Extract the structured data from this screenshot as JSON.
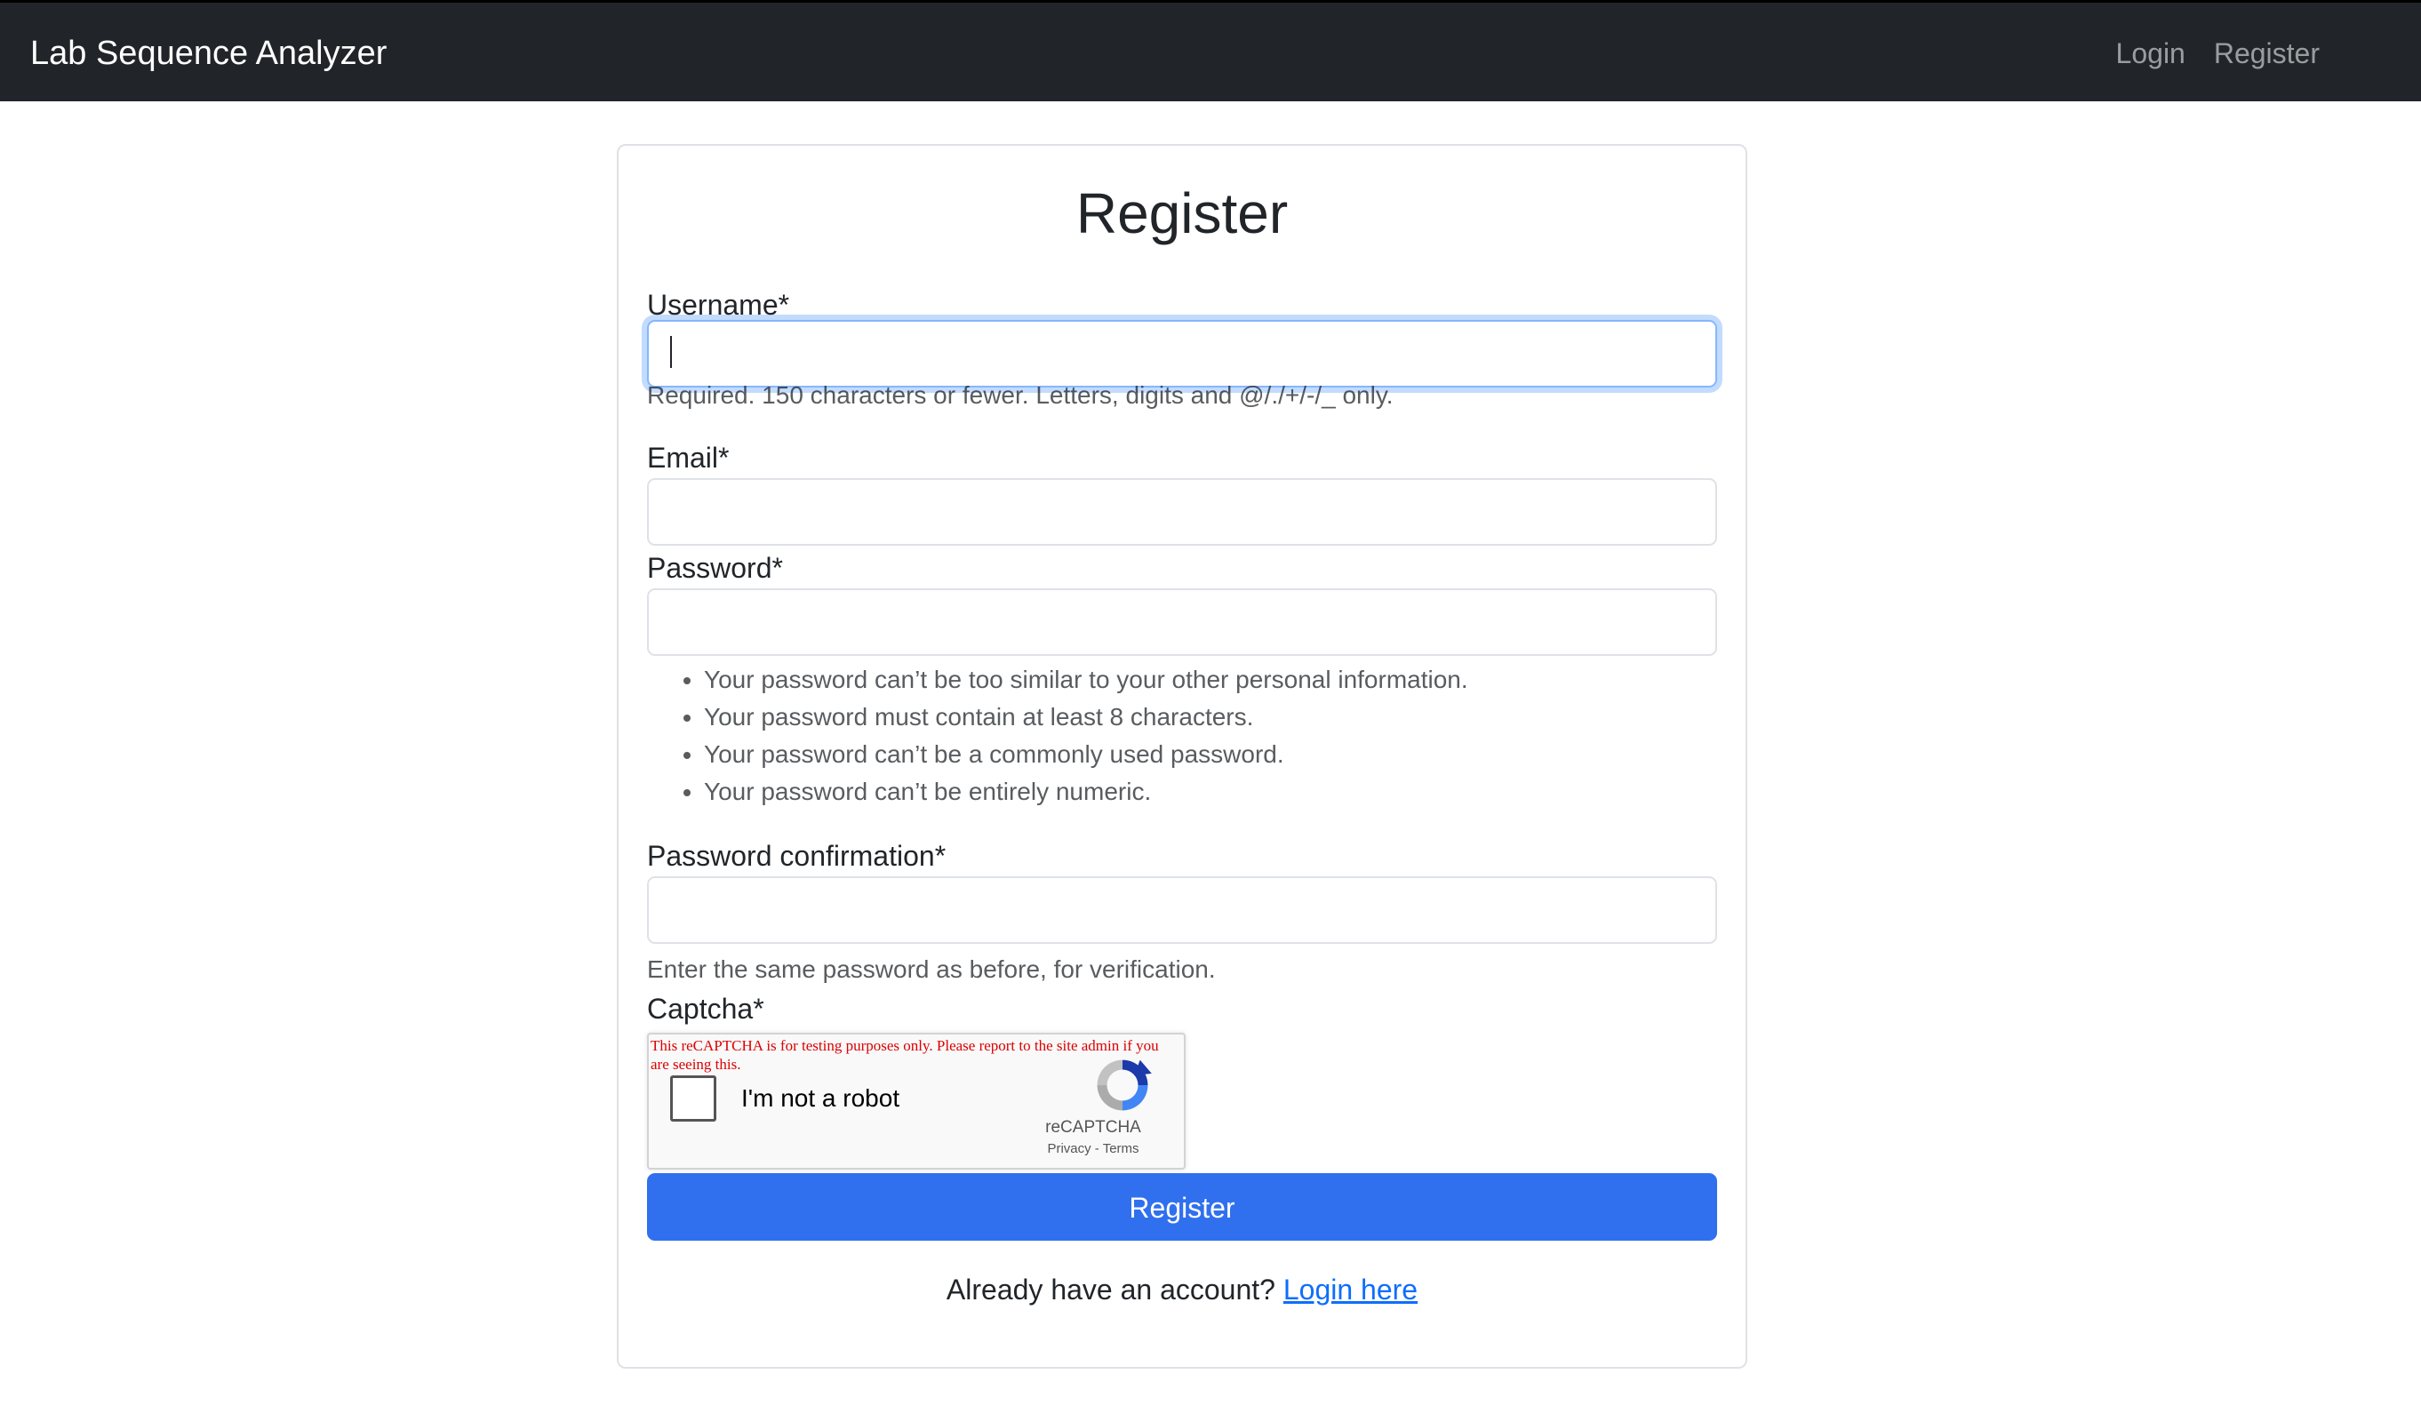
{
  "navbar": {
    "brand": "Lab Sequence Analyzer",
    "links": [
      "Login",
      "Register"
    ]
  },
  "form": {
    "title": "Register",
    "username": {
      "label": "Username*",
      "value": "",
      "help": "Required. 150 characters or fewer. Letters, digits and @/./+/-/_ only."
    },
    "email": {
      "label": "Email*",
      "value": ""
    },
    "password": {
      "label": "Password*",
      "value": "",
      "rules": [
        "Your password can’t be too similar to your other personal information.",
        "Your password must contain at least 8 characters.",
        "Your password can’t be a commonly used password.",
        "Your password can’t be entirely numeric."
      ]
    },
    "password_confirmation": {
      "label": "Password confirmation*",
      "value": "",
      "help": "Enter the same password as before, for verification."
    },
    "captcha": {
      "label": "Captcha*",
      "warning": "This reCAPTCHA is for testing purposes only. Please report to the site admin if you are seeing this.",
      "checkbox_label": "I'm not a robot",
      "brand": "reCAPTCHA",
      "privacy": "Privacy",
      "separator": " - ",
      "terms": "Terms"
    },
    "submit_label": "Register",
    "footer_prompt": "Already have an account? ",
    "footer_link": "Login here"
  },
  "colors": {
    "navbar_bg": "#212529",
    "primary": "#3070ef",
    "link": "#0d6efd",
    "focus_border": "#86b7fe",
    "captcha_warning": "#dd0000"
  }
}
